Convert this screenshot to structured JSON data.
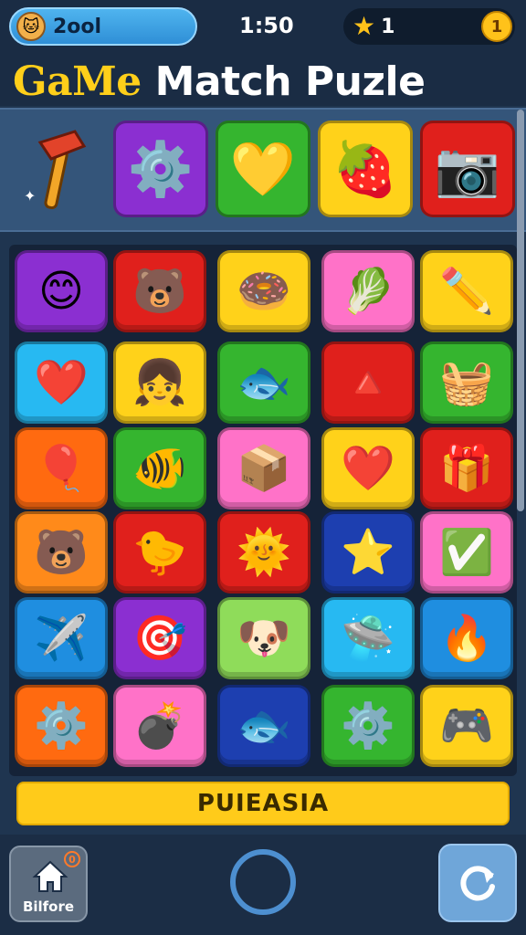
{
  "status": {
    "user_name": "2ool",
    "avatar_icon": "cat-face-icon",
    "time": "1:50",
    "stars": "1",
    "coin_label": "1"
  },
  "title": {
    "part1": "GaMe",
    "part2": "Match Puzle"
  },
  "goals": {
    "powerup_icon": "hammer-icon",
    "items": [
      {
        "icon": "gear-gem-icon",
        "glyph": "⚙️",
        "color": "#8b2fd1"
      },
      {
        "icon": "yellow-heart-icon",
        "glyph": "💛",
        "color": "#35b52f"
      },
      {
        "icon": "strawberry-heart-icon",
        "glyph": "🍓",
        "color": "#ffd21a"
      },
      {
        "icon": "camera-icon",
        "glyph": "📷",
        "color": "#e0201c"
      }
    ]
  },
  "board": {
    "rows": [
      [
        {
          "icon": "smiley-icon",
          "glyph": "😊",
          "color": "#8b2fd1"
        },
        {
          "icon": "bear-gear-icon",
          "glyph": "🐻",
          "color": "#e0201c"
        },
        {
          "icon": "donut-box-icon",
          "glyph": "🍩",
          "color": "#ffd21a"
        },
        {
          "icon": "blue-leaf-icon",
          "glyph": "🥬",
          "color": "#ff72c8"
        },
        {
          "icon": "eraser-icon",
          "glyph": "✏️",
          "color": "#ffd21a"
        }
      ],
      [
        {
          "icon": "heart-icon",
          "glyph": "❤️",
          "color": "#27b9f2"
        },
        {
          "icon": "girl-face-icon",
          "glyph": "👧",
          "color": "#ffd21a"
        },
        {
          "icon": "fish-icon",
          "glyph": "🐟",
          "color": "#35b52f"
        },
        {
          "icon": "cone-icon",
          "glyph": "🔺",
          "color": "#e0201c"
        },
        {
          "icon": "basket-icon",
          "glyph": "🧺",
          "color": "#35b52f"
        }
      ],
      [
        {
          "icon": "balloon-icon",
          "glyph": "🎈",
          "color": "#ff6a10"
        },
        {
          "icon": "green-fish-icon",
          "glyph": "🐠",
          "color": "#35b52f"
        },
        {
          "icon": "monster-box-icon",
          "glyph": "📦",
          "color": "#ff72c8"
        },
        {
          "icon": "heart-icon",
          "glyph": "❤️",
          "color": "#ffd21a"
        },
        {
          "icon": "chest-icon",
          "glyph": "🎁",
          "color": "#e0201c"
        }
      ],
      [
        {
          "icon": "bear-face-icon",
          "glyph": "🐻",
          "color": "#ff8a1a"
        },
        {
          "icon": "green-bird-icon",
          "glyph": "🐤",
          "color": "#e0201c"
        },
        {
          "icon": "sun-coin-icon",
          "glyph": "🌞",
          "color": "#e0201c"
        },
        {
          "icon": "star-creature-icon",
          "glyph": "⭐",
          "color": "#1d3fb0"
        },
        {
          "icon": "check-badge-icon",
          "glyph": "✅",
          "color": "#ff72c8"
        }
      ],
      [
        {
          "icon": "plane-fish-icon",
          "glyph": "✈️",
          "color": "#1f8ee0"
        },
        {
          "icon": "target-icon",
          "glyph": "🎯",
          "color": "#8b2fd1"
        },
        {
          "icon": "dog-face-icon",
          "glyph": "🐶",
          "color": "#8fdc5a"
        },
        {
          "icon": "ufo-icon",
          "glyph": "🛸",
          "color": "#27b9f2"
        },
        {
          "icon": "fire-creature-icon",
          "glyph": "🔥",
          "color": "#1f8ee0"
        }
      ],
      [
        {
          "icon": "blue-gear-icon",
          "glyph": "⚙️",
          "color": "#ff6a10"
        },
        {
          "icon": "bomb-icon",
          "glyph": "💣",
          "color": "#ff72c8"
        },
        {
          "icon": "fish-icon",
          "glyph": "🐟",
          "color": "#1d3fb0"
        },
        {
          "icon": "purple-gear-icon",
          "glyph": "⚙️",
          "color": "#35b52f"
        },
        {
          "icon": "pink-machine-icon",
          "glyph": "🎮",
          "color": "#ffd21a"
        }
      ]
    ]
  },
  "banner": "PUIEASIA",
  "bottom": {
    "home_label": "Bilfore",
    "home_badge": "0",
    "refresh_icon": "refresh-icon"
  }
}
